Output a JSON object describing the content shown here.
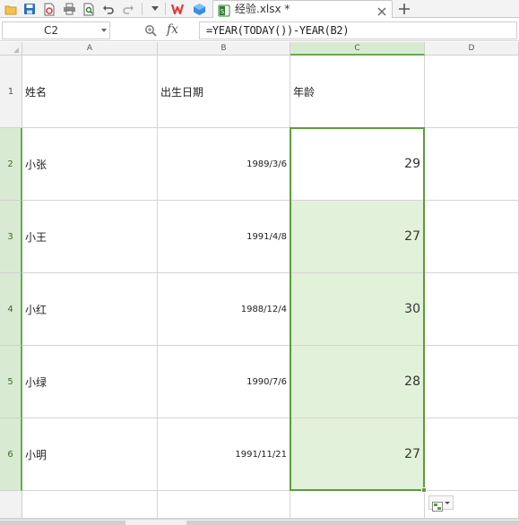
{
  "file_tab": {
    "name": "经验.xlsx *"
  },
  "formula_bar": {
    "cell_ref": "C2",
    "fx_label": "fx",
    "formula": "=YEAR(TODAY())-YEAR(B2)"
  },
  "columns": [
    "A",
    "B",
    "C",
    "D"
  ],
  "rows": [
    "1",
    "2",
    "3",
    "4",
    "5",
    "6"
  ],
  "sheet": {
    "header": [
      "姓名",
      "出生日期",
      "年龄"
    ],
    "data": [
      [
        "小张",
        "1989/3/6",
        "29"
      ],
      [
        "小王",
        "1991/4/8",
        "27"
      ],
      [
        "小红",
        "1988/12/4",
        "30"
      ],
      [
        "小绿",
        "1990/7/6",
        "28"
      ],
      [
        "小明",
        "1991/11/21",
        "27"
      ]
    ]
  },
  "colors": {
    "selection_border": "#5c9c3e",
    "selection_fill": "#e2f1d9",
    "header_selected": "#d9ead2",
    "wps_red": "#e03a3a",
    "toolbar_blue": "#2e6db4"
  },
  "icons": [
    "save-icon",
    "export-pdf-icon",
    "print-icon",
    "print-preview-icon",
    "undo-icon",
    "redo-icon",
    "more-dropdown-icon",
    "wps-logo-icon",
    "cloud-cube-icon",
    "excel-file-icon",
    "close-icon",
    "add-tab-icon",
    "zoom-formula-icon",
    "paste-options-icon"
  ]
}
